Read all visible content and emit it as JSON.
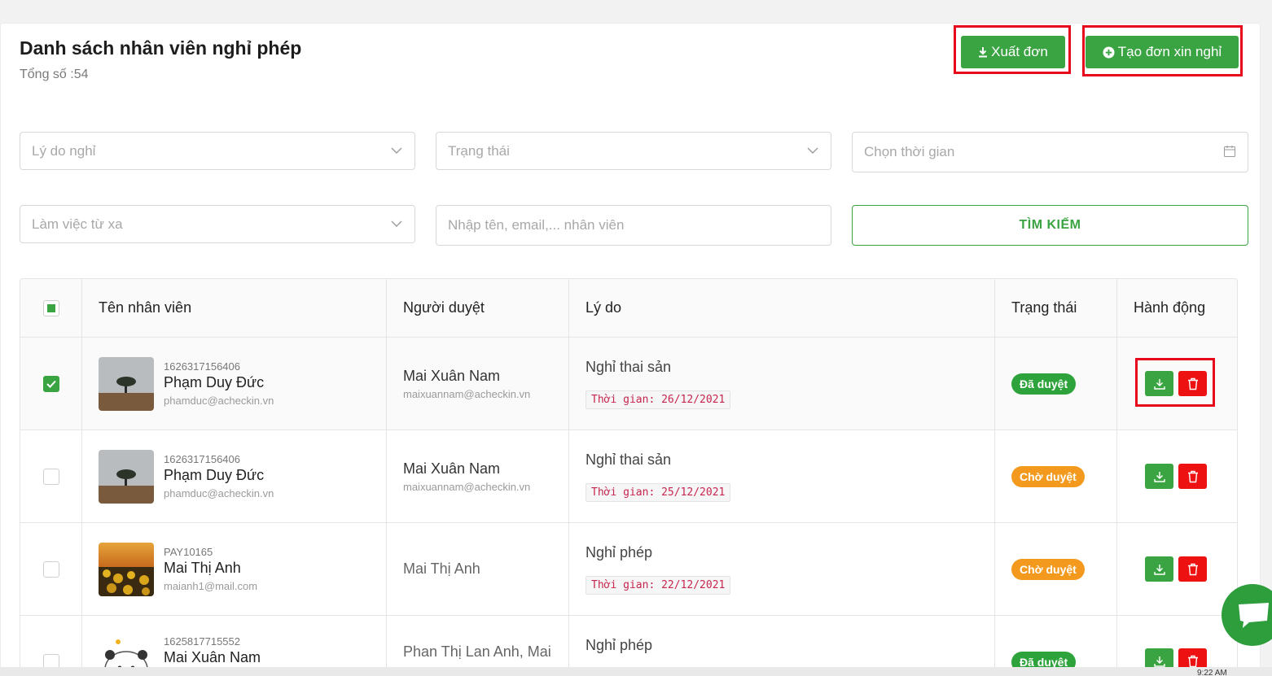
{
  "header": {
    "title": "Danh sách nhân viên nghỉ phép",
    "total_label": "Tổng số :54",
    "export_label": "Xuất đơn",
    "create_label": "Tạo đơn xin nghỉ"
  },
  "filters": {
    "reason_placeholder": "Lý do nghỉ",
    "status_placeholder": "Trạng thái",
    "time_placeholder": "Chọn thời gian",
    "remote_placeholder": "Làm việc từ xa",
    "search_placeholder": "Nhập tên, email,... nhân viên",
    "search_button": "TÌM KIẾM"
  },
  "table": {
    "columns": [
      "Tên nhân viên",
      "Người duyệt",
      "Lý do",
      "Trạng thái",
      "Hành động"
    ],
    "rows": [
      {
        "code": "1626317156406",
        "name": "Phạm Duy Đức",
        "email": "phamduc@acheckin.vn",
        "approver": "Mai Xuân Nam",
        "approver_email": "maixuannam@acheckin.vn",
        "reason": "Nghỉ thai sản",
        "time": "Thời gian: 26/12/2021",
        "status": "Đã duyệt"
      },
      {
        "code": "1626317156406",
        "name": "Phạm Duy Đức",
        "email": "phamduc@acheckin.vn",
        "approver": "Mai Xuân Nam",
        "approver_email": "maixuannam@acheckin.vn",
        "reason": "Nghỉ thai sản",
        "time": "Thời gian: 25/12/2021",
        "status": "Chờ duyệt"
      },
      {
        "code": "PAY10165",
        "name": "Mai Thị Anh",
        "email": "maianh1@mail.com",
        "approver": "Mai Thị Anh",
        "reason": "Nghỉ phép",
        "time": "Thời gian: 22/12/2021",
        "status": "Chờ duyệt"
      },
      {
        "code": "1625817715552",
        "name": "Mai Xuân Nam",
        "approver": "Phan Thị Lan Anh, Mai",
        "reason": "Nghỉ phép",
        "status": "Đã duyệt"
      }
    ]
  },
  "system": {
    "clock": "9:22 AM"
  },
  "colors": {
    "accent": "#3aa342",
    "danger": "#ee1111",
    "pending": "#f39a1e",
    "highlight": "#e8081c"
  }
}
